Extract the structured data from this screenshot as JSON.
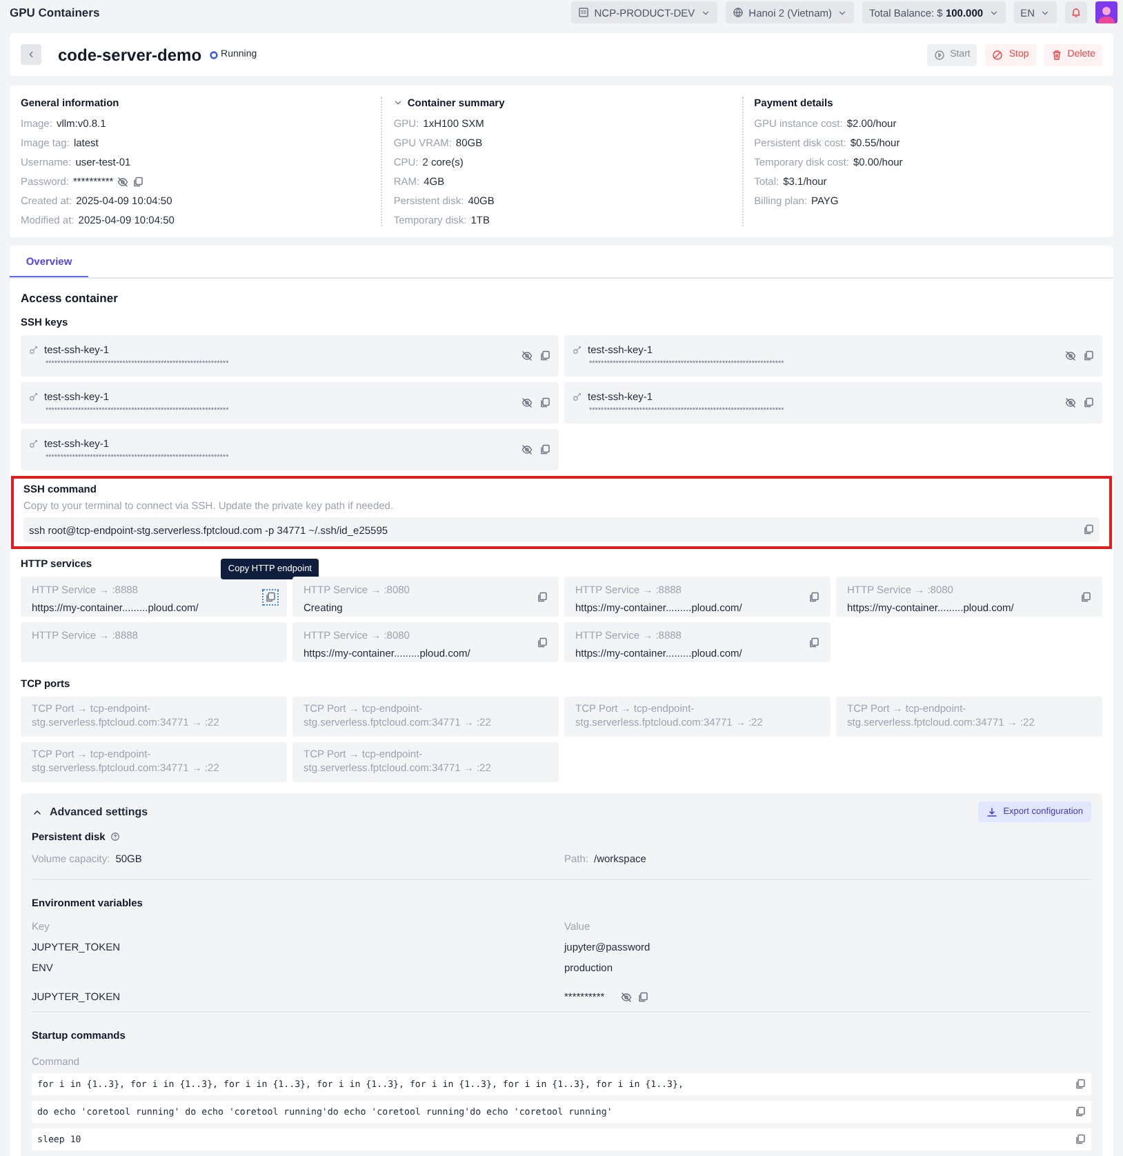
{
  "app_title": "GPU Containers",
  "top_bar": {
    "project": "NCP-PRODUCT-DEV",
    "region": "Hanoi 2 (Vietnam)",
    "balance_label": "Total Balance: $",
    "balance_value": "100.000",
    "language": "EN"
  },
  "header": {
    "name": "code-server-demo",
    "status": "Running",
    "buttons": [
      {
        "label": "Start",
        "kind": "start",
        "disabled": true
      },
      {
        "label": "Stop",
        "kind": "stop",
        "disabled": false
      },
      {
        "label": "Delete",
        "kind": "delete",
        "disabled": false
      }
    ]
  },
  "info_columns": [
    {
      "title": "General information",
      "collapsible": false,
      "fields": [
        {
          "label": "Image:",
          "value": "vllm:v0.8.1",
          "kind": "text"
        },
        {
          "label": "Image tag:",
          "value": "latest",
          "kind": "text"
        },
        {
          "label": "Username:",
          "value": "user-test-01",
          "kind": "text"
        },
        {
          "label": "Password:",
          "value": "**********",
          "kind": "secret"
        },
        {
          "label": "Created at:",
          "value": "2025-04-09 10:04:50",
          "kind": "text"
        },
        {
          "label": "Modified at:",
          "value": "2025-04-09 10:04:50",
          "kind": "text"
        }
      ]
    },
    {
      "title": "Container summary",
      "collapsible": true,
      "fields": [
        {
          "label": "GPU:",
          "value": "1xH100 SXM",
          "kind": "text"
        },
        {
          "label": "GPU VRAM:",
          "value": "80GB",
          "kind": "text"
        },
        {
          "label": "CPU:",
          "value": "2 core(s)",
          "kind": "text"
        },
        {
          "label": "RAM:",
          "value": "4GB",
          "kind": "text"
        },
        {
          "label": "Persistent disk:",
          "value": "40GB",
          "kind": "text"
        },
        {
          "label": "Temporary disk:",
          "value": "1TB",
          "kind": "text"
        }
      ]
    },
    {
      "title": "Payment details",
      "collapsible": false,
      "fields": [
        {
          "label": "GPU instance cost:",
          "value": "$2.00/hour",
          "kind": "text"
        },
        {
          "label": "Persistent disk cost:",
          "value": "$0.55/hour",
          "kind": "text"
        },
        {
          "label": "Temporary disk cost:",
          "value": "$0.00/hour",
          "kind": "text"
        },
        {
          "label": "Total:",
          "value": "$3.1/hour",
          "kind": "text"
        },
        {
          "label": "Billing plan:",
          "value": "PAYG",
          "kind": "text"
        }
      ]
    }
  ],
  "tabs": [
    {
      "label": "Overview",
      "selected": true
    }
  ],
  "access_container": {
    "title": "Access container",
    "ssh_keys": {
      "label": "SSH keys",
      "keys": [
        {
          "name": "test-ssh-key-1",
          "value": "**************************************************************"
        },
        {
          "name": "test-ssh-key-1",
          "value": "******************************************************************"
        },
        {
          "name": "test-ssh-key-1",
          "value": "**************************************************************"
        },
        {
          "name": "test-ssh-key-1",
          "value": "******************************************************************"
        },
        {
          "name": "test-ssh-key-1",
          "value": "**************************************************************"
        }
      ]
    },
    "ssh_command": {
      "title": "SSH command",
      "description": "Copy to your terminal to connect via SSH. Update the private key path if needed.",
      "command": "ssh root@tcp-endpoint-stg.serverless.fptcloud.com -p 34771  ~/.ssh/id_e25595",
      "highlighted": true
    },
    "http_services": {
      "label": "HTTP services",
      "services": [
        {
          "name": "HTTP Service → :8888",
          "url": "https://my-container.........ploud.com/",
          "tooltip": "Copy HTTP endpoint"
        },
        {
          "name": "HTTP Service → :8080",
          "url": "Creating"
        },
        {
          "name": "HTTP Service → :8888",
          "url": "https://my-container.........ploud.com/"
        },
        {
          "name": "HTTP Service → :8080",
          "url": "https://my-container.........ploud.com/"
        },
        {
          "name": "HTTP Service → :8888"
        },
        {
          "name": "HTTP Service → :8080",
          "url": "https://my-container.........ploud.com/"
        },
        {
          "name": "HTTP Service → :8888",
          "url": "https://my-container.........ploud.com/"
        }
      ]
    },
    "tcp_ports": {
      "label": "TCP ports",
      "ports": [
        "TCP Port → tcp-endpoint-stg.serverless.fptcloud.com:34771 → :22",
        "TCP Port → tcp-endpoint-stg.serverless.fptcloud.com:34771 → :22",
        "TCP Port → tcp-endpoint-stg.serverless.fptcloud.com:34771 → :22",
        "TCP Port → tcp-endpoint-stg.serverless.fptcloud.com:34771 → :22",
        "TCP Port → tcp-endpoint-stg.serverless.fptcloud.com:34771 → :22",
        "TCP Port → tcp-endpoint-stg.serverless.fptcloud.com:34771 → :22"
      ]
    }
  },
  "advanced_settings": {
    "title": "Advanced settings",
    "expanded": true,
    "export_button": "Export configuration",
    "persistent_disk": {
      "title": "Persistent disk",
      "capacity_label": "Volume capacity:",
      "capacity": "50GB",
      "path_label": "Path:",
      "path": "/workspace"
    },
    "environment_variables": {
      "title": "Environment variables",
      "key_header": "Key",
      "value_header": "Value",
      "rows": [
        {
          "key": "JUPYTER_TOKEN",
          "value": "jupyter@password",
          "kind": "text"
        },
        {
          "key": "ENV",
          "value": "production",
          "kind": "text"
        },
        {
          "key": "JUPYTER_TOKEN",
          "value": "**********",
          "kind": "secret"
        }
      ]
    },
    "startup_commands": {
      "title": "Startup commands",
      "header": "Command",
      "commands": [
        "for i in {1..3}, for i in {1..3}, for i in {1..3}, for i in {1..3}, for i in {1..3}, for i in {1..3}, for i in {1..3},",
        "do echo 'coretool running' do echo 'coretool running'do echo 'coretool running'do echo 'coretool running'",
        "sleep 10"
      ]
    }
  }
}
